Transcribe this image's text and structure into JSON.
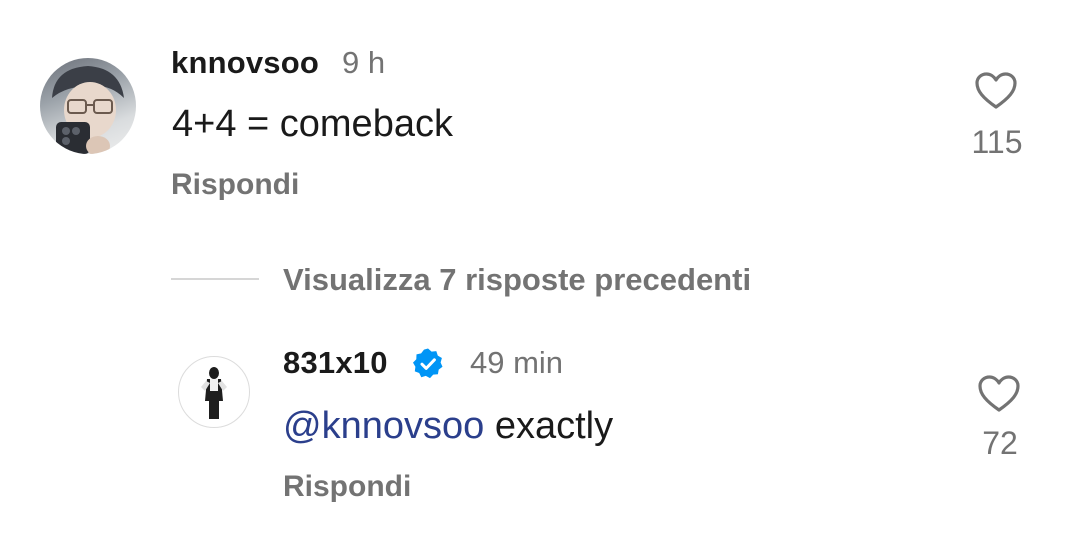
{
  "comments": [
    {
      "username": "knnovsoo",
      "time": "9 h",
      "text": "4+4 = comeback",
      "likes": "115",
      "reply_label": "Rispondi",
      "avatar_icon": "profile-photo-icon",
      "heart_icon": "heart-outline-icon"
    },
    {
      "username": "831x10",
      "verified": true,
      "time": "49 min",
      "mention": "@knnovsoo",
      "text": "exactly",
      "likes": "72",
      "reply_label": "Rispondi",
      "avatar_icon": "profile-photo-icon",
      "heart_icon": "heart-outline-icon"
    }
  ],
  "view_replies": {
    "label": "Visualizza 7 risposte precedenti"
  },
  "colors": {
    "secondary_text": "#737373",
    "primary_text": "#1a1a1a",
    "mention": "#2b3f8c",
    "verified_badge": "#0095f6"
  }
}
